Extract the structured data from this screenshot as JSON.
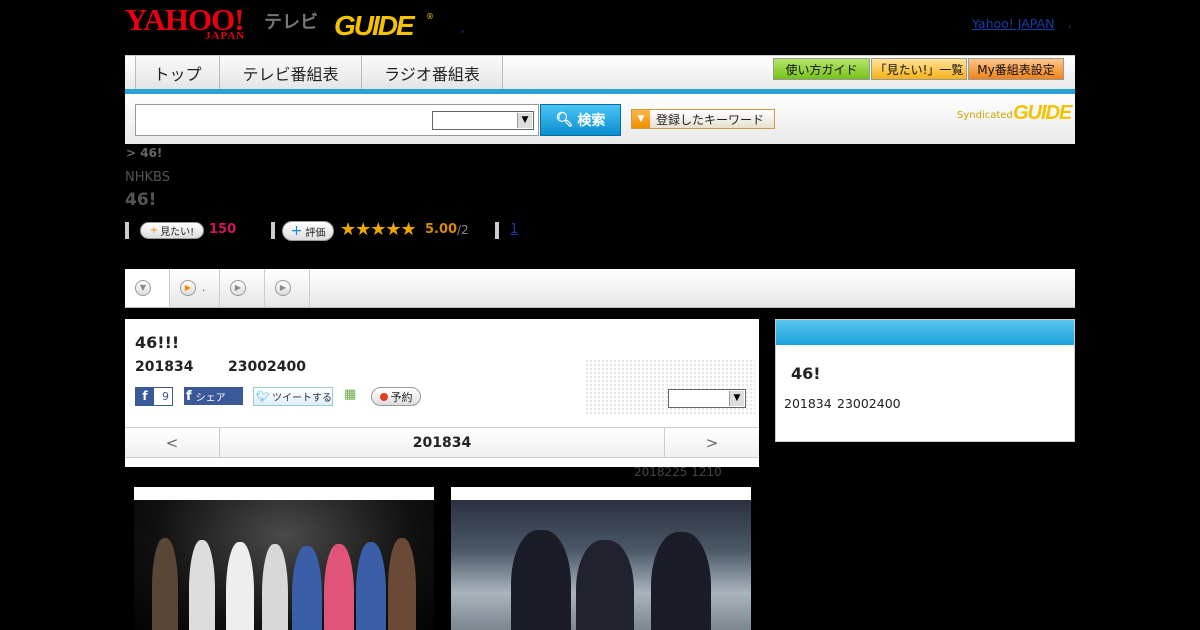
{
  "header": {
    "yahoo_logo": "YAHOO!",
    "yahoo_logo_sub": "JAPAN",
    "tv_label": "テレビ",
    "gguide_logo": "GUIDE",
    "gguide_reg": "®",
    "dot_mid": ",",
    "yahoo_japan_link": "Yahoo! JAPAN",
    "dot_right": ","
  },
  "nav": {
    "tabs": [
      {
        "label": "トップ"
      },
      {
        "label": "テレビ番組表"
      },
      {
        "label": "ラジオ番組表"
      }
    ],
    "right_buttons": [
      {
        "label": "使い方ガイド",
        "color": "#75c21b"
      },
      {
        "label": "「見たい!」一覧",
        "color": "#f6b316"
      },
      {
        "label": "My番組表設定",
        "color": "#f08316"
      }
    ]
  },
  "search": {
    "input_value": "",
    "select_value": "",
    "button_label": "検索",
    "keyword_button_label": "登録したキーワード",
    "syndicated_label": "Syndicated",
    "syndicated_logo": "GUIDE"
  },
  "program": {
    "breadcrumb": "> 46!",
    "channel": "NHKBS",
    "title": "46!",
    "mitai_label": "見たい!",
    "mitai_count": "150",
    "hyoka_label": "評価",
    "stars": "★★★★★",
    "score": "5.00",
    "score_total": "/2",
    "review_count": "1"
  },
  "subtabs": [
    {
      "icon": "down-arrow-icon",
      "label": ""
    },
    {
      "icon": "play-icon",
      "label": "."
    },
    {
      "icon": "play-icon",
      "label": ""
    },
    {
      "icon": "play-icon",
      "label": ""
    }
  ],
  "main": {
    "title": "46!!!",
    "date": "201834",
    "time": "23002400",
    "fb_like_count": "9",
    "fb_share_label": "シェア",
    "tweet_label": "ツイートする",
    "yoyaku_label": "予約",
    "select_value": "",
    "nav_prev": "<",
    "nav_date": "201834",
    "nav_next": ">",
    "updated": "2018225  1210"
  },
  "side": {
    "title": "46!",
    "date": "201834",
    "time": "23002400"
  },
  "colors": {
    "accent_blue": "#2ba2d6",
    "yahoo_red": "#e60012",
    "gguide_yellow": "#f4c300",
    "mitai_pink": "#d4145a"
  }
}
